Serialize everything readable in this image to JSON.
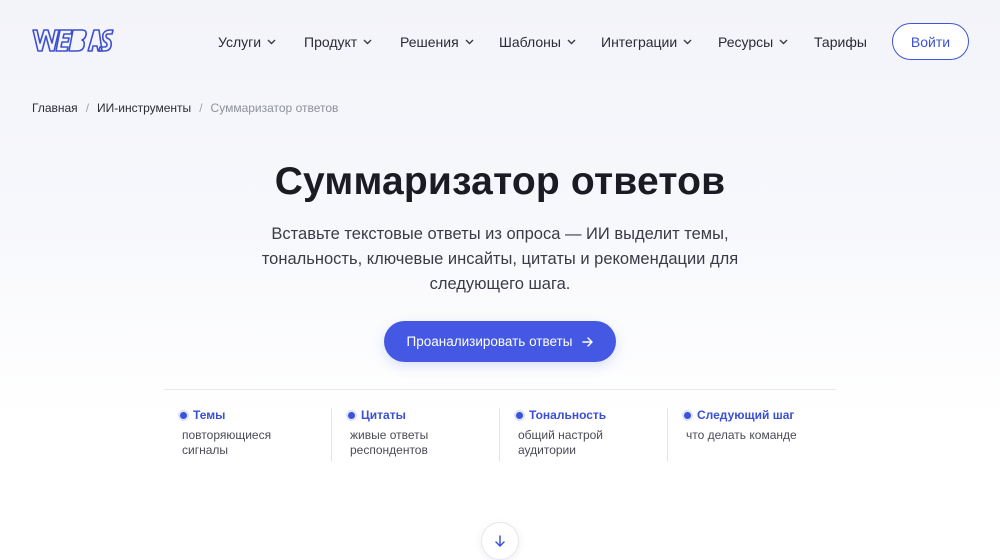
{
  "brand": {
    "logo_text": "VEBASK",
    "accent": "#4458e4"
  },
  "nav": {
    "items": [
      {
        "label": "Услуги",
        "has_dropdown": true
      },
      {
        "label": "Продукт",
        "has_dropdown": true
      },
      {
        "label": "Решения",
        "has_dropdown": true
      },
      {
        "label": "Шаблоны",
        "has_dropdown": true
      },
      {
        "label": "Интеграции",
        "has_dropdown": true
      },
      {
        "label": "Ресурсы",
        "has_dropdown": true
      },
      {
        "label": "Тарифы",
        "has_dropdown": false
      }
    ],
    "login_label": "Войти"
  },
  "breadcrumb": {
    "items": [
      "Главная",
      "ИИ-инструменты"
    ],
    "current": "Суммаризатор ответов",
    "separator": "/"
  },
  "hero": {
    "title": "Суммаризатор ответов",
    "description_lines": [
      "Вставьте текстовые ответы из опроса — ИИ выделит темы,",
      "тональность, ключевые инсайты, цитаты и рекомендации для",
      "следующего шага."
    ],
    "cta_label": "Проанализировать ответы"
  },
  "features": [
    {
      "title": "Темы",
      "lines": [
        "повторяющиеся",
        "сигналы"
      ]
    },
    {
      "title": "Цитаты",
      "lines": [
        "живые ответы",
        "респондентов"
      ]
    },
    {
      "title": "Тональность",
      "lines": [
        "общий настрой",
        "аудитории"
      ]
    },
    {
      "title": "Следующий шаг",
      "lines": [
        "что делать команде"
      ]
    }
  ],
  "icons": {
    "chevron": "chevron-down-icon",
    "cta_arrow": "arrow-right-icon",
    "scroll": "arrow-down-icon"
  }
}
